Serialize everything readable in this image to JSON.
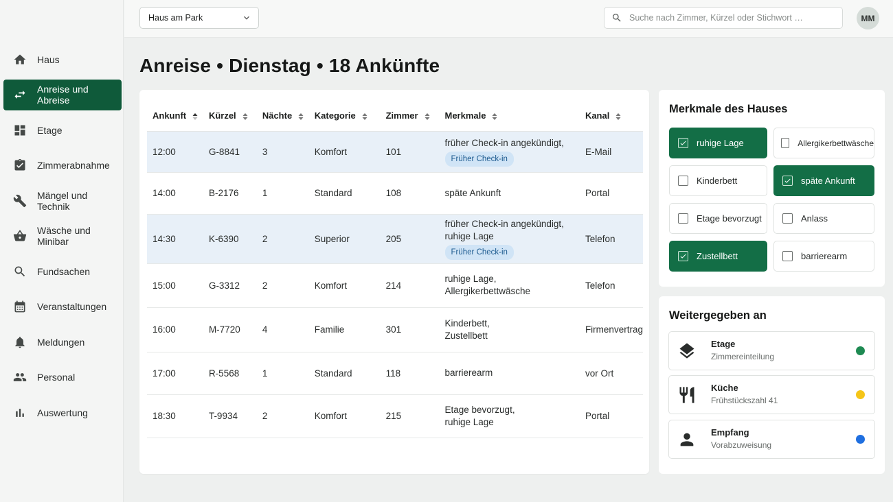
{
  "topbar": {
    "house_select": "Haus am Park",
    "search_placeholder": "Suche nach Zimmer, Kürzel oder Stichwort …",
    "avatar_initials": "MM"
  },
  "sidebar": {
    "items": [
      {
        "label": "Haus",
        "icon": "home-icon"
      },
      {
        "label": "Anreise und Abreise",
        "icon": "swap-arrows-icon",
        "active": true
      },
      {
        "label": "Etage",
        "icon": "grid-icon"
      },
      {
        "label": "Zimmerabnahme",
        "icon": "clipboard-check-icon"
      },
      {
        "label": "Mängel und Technik",
        "icon": "wrench-icon"
      },
      {
        "label": "Wäsche und Minibar",
        "icon": "basket-icon"
      },
      {
        "label": "Fundsachen",
        "icon": "search-icon"
      },
      {
        "label": "Veranstaltungen",
        "icon": "calendar-icon"
      },
      {
        "label": "Meldungen",
        "icon": "bell-icon"
      },
      {
        "label": "Personal",
        "icon": "people-icon"
      },
      {
        "label": "Auswertung",
        "icon": "bar-chart-icon"
      }
    ]
  },
  "page": {
    "title": "Anreise • Dienstag • 18 Ankünfte"
  },
  "table": {
    "headers": [
      "Ankunft",
      "Kürzel",
      "Nächte",
      "Kategorie",
      "Zimmer",
      "Merkmale",
      "Kanal"
    ],
    "rows": [
      {
        "arrival": "12:00",
        "code": "G-8841",
        "nights": "3",
        "category": "Komfort",
        "room": "101",
        "features": [
          "früher Check-in angekündigt,"
        ],
        "chip": "Früher Check-in",
        "channel": "E-Mail",
        "highlight": true
      },
      {
        "arrival": "14:00",
        "code": "B-2176",
        "nights": "1",
        "category": "Standard",
        "room": "108",
        "features": [
          "späte Ankunft"
        ],
        "chip": "",
        "channel": "Portal",
        "highlight": false
      },
      {
        "arrival": "14:30",
        "code": "K-6390",
        "nights": "2",
        "category": "Superior",
        "room": "205",
        "features": [
          "früher Check-in angekündigt,",
          "ruhige Lage"
        ],
        "chip": "Früher Check-in",
        "channel": "Telefon",
        "highlight": true
      },
      {
        "arrival": "15:00",
        "code": "G-3312",
        "nights": "2",
        "category": "Komfort",
        "room": "214",
        "features": [
          "ruhige Lage,",
          "Allergikerbettwäsche"
        ],
        "chip": "",
        "channel": "Telefon",
        "highlight": false
      },
      {
        "arrival": "16:00",
        "code": "M-7720",
        "nights": "4",
        "category": "Familie",
        "room": "301",
        "features": [
          "Kinderbett,",
          "Zustellbett"
        ],
        "chip": "",
        "channel": "Firmenvertrag",
        "highlight": false
      },
      {
        "arrival": "17:00",
        "code": "R-5568",
        "nights": "1",
        "category": "Standard",
        "room": "118",
        "features": [
          "barrierearm"
        ],
        "chip": "",
        "channel": "vor Ort",
        "highlight": false
      },
      {
        "arrival": "18:30",
        "code": "T-9934",
        "nights": "2",
        "category": "Komfort",
        "room": "215",
        "features": [
          "Etage bevorzugt,",
          "ruhige Lage"
        ],
        "chip": "",
        "channel": "Portal",
        "highlight": false
      }
    ]
  },
  "features_panel": {
    "title": "Merkmale des Hauses",
    "items": [
      {
        "label": "ruhige Lage",
        "checked": true
      },
      {
        "label": "Allergikerbettwäsche",
        "checked": false
      },
      {
        "label": "Kinderbett",
        "checked": false
      },
      {
        "label": "späte Ankunft",
        "checked": true
      },
      {
        "label": "Etage bevorzugt",
        "checked": false
      },
      {
        "label": "Anlass",
        "checked": false
      },
      {
        "label": "Zustellbett",
        "checked": true
      },
      {
        "label": "barrierearm",
        "checked": false
      }
    ]
  },
  "forwarded_panel": {
    "title": "Weitergegeben an",
    "items": [
      {
        "name": "Etage",
        "sub": "Zimmereinteilung",
        "icon": "layers-icon",
        "status_color": "#1e8a52"
      },
      {
        "name": "Küche",
        "sub": "Frühstückszahl 41",
        "icon": "cutlery-icon",
        "status_color": "#f5c518"
      },
      {
        "name": "Empfang",
        "sub": "Vorabzuweisung",
        "icon": "person-icon",
        "status_color": "#1f6fe0"
      }
    ]
  }
}
